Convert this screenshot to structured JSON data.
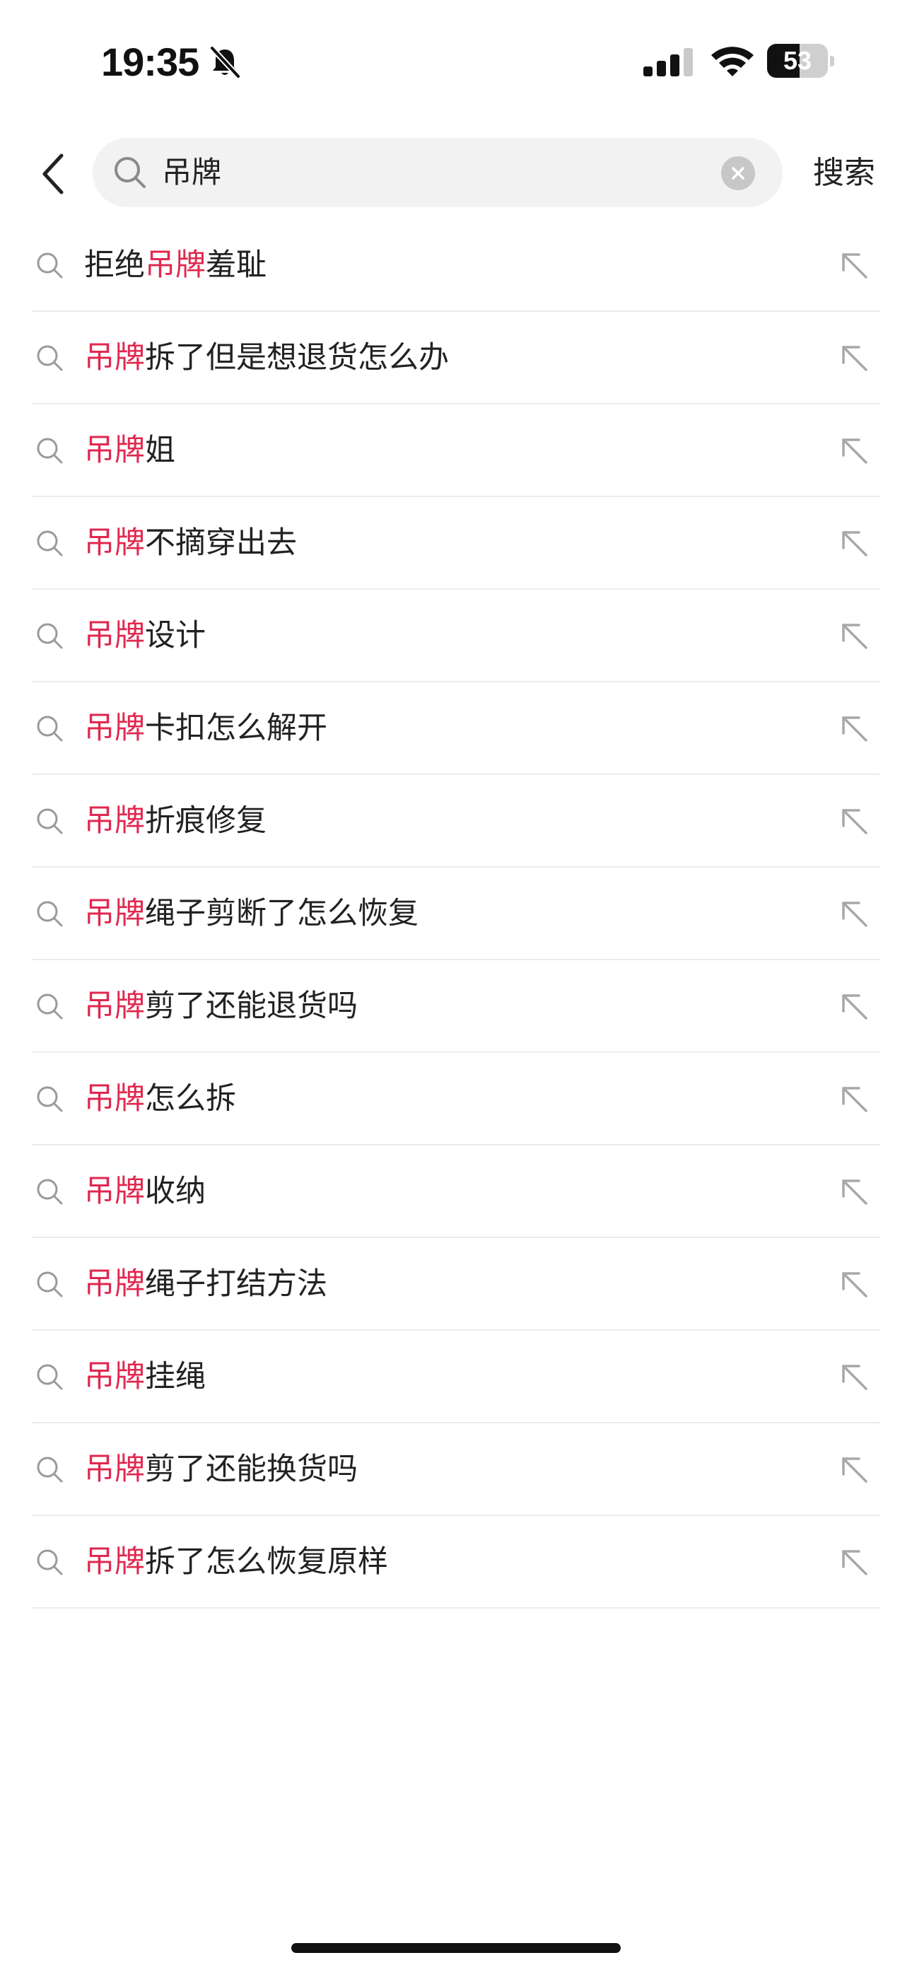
{
  "status_bar": {
    "time": "19:35",
    "battery": "53",
    "battery_level_percent": 53
  },
  "header": {
    "query": "吊牌",
    "search_label": "搜索"
  },
  "colors": {
    "highlight": "#e0284f",
    "text": "#222222",
    "divider": "#ececec",
    "search_bg": "#f2f2f2"
  },
  "icons": {
    "back": "chevron-left-icon",
    "search": "search-icon",
    "clear": "clear-icon",
    "fill": "arrow-up-left-icon"
  },
  "suggestions": [
    {
      "pre": "拒绝",
      "hl": "吊牌",
      "post": "羞耻"
    },
    {
      "pre": "",
      "hl": "吊牌",
      "post": "拆了但是想退货怎么办"
    },
    {
      "pre": "",
      "hl": "吊牌",
      "post": "姐"
    },
    {
      "pre": "",
      "hl": "吊牌",
      "post": "不摘穿出去"
    },
    {
      "pre": "",
      "hl": "吊牌",
      "post": "设计"
    },
    {
      "pre": "",
      "hl": "吊牌",
      "post": "卡扣怎么解开"
    },
    {
      "pre": "",
      "hl": "吊牌",
      "post": "折痕修复"
    },
    {
      "pre": "",
      "hl": "吊牌",
      "post": "绳子剪断了怎么恢复"
    },
    {
      "pre": "",
      "hl": "吊牌",
      "post": "剪了还能退货吗"
    },
    {
      "pre": "",
      "hl": "吊牌",
      "post": "怎么拆"
    },
    {
      "pre": "",
      "hl": "吊牌",
      "post": "收纳"
    },
    {
      "pre": "",
      "hl": "吊牌",
      "post": "绳子打结方法"
    },
    {
      "pre": "",
      "hl": "吊牌",
      "post": "挂绳"
    },
    {
      "pre": "",
      "hl": "吊牌",
      "post": "剪了还能换货吗"
    },
    {
      "pre": "",
      "hl": "吊牌",
      "post": "拆了怎么恢复原样"
    }
  ]
}
